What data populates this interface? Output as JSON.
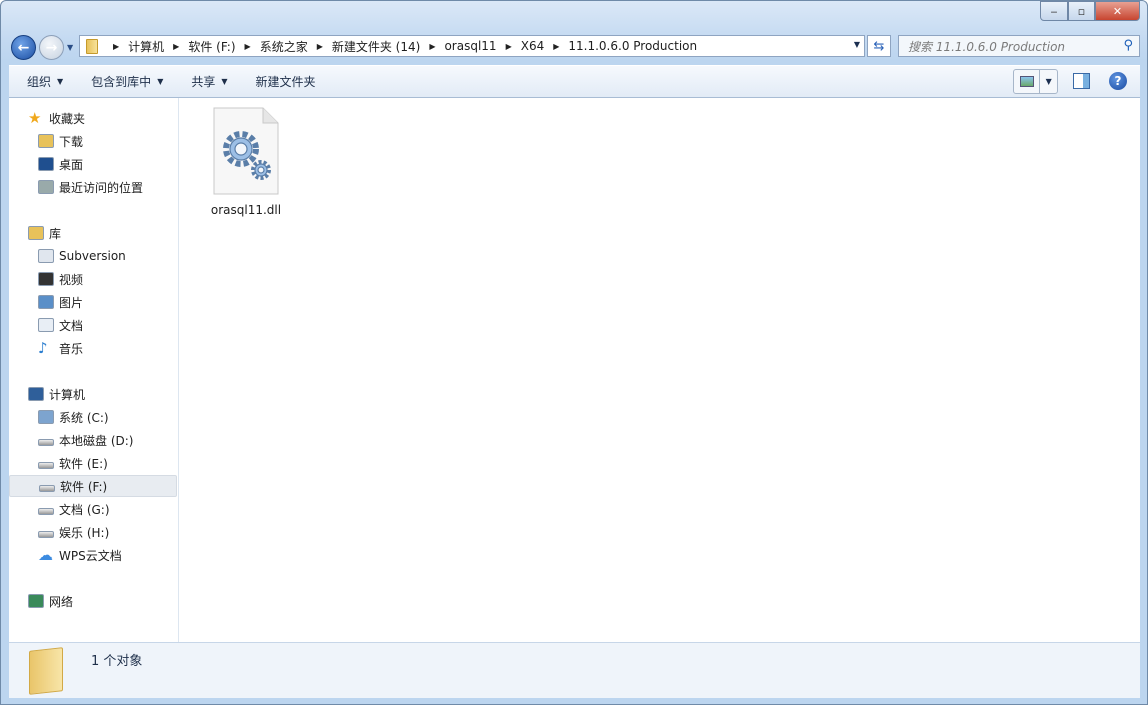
{
  "window": {
    "minimize": "‒",
    "maximize": "▫",
    "close": "✕"
  },
  "address": {
    "crumbs": [
      "计算机",
      "软件 (F:)",
      "系统之家",
      "新建文件夹 (14)",
      "orasql11",
      "X64",
      "11.1.0.6.0 Production"
    ]
  },
  "search": {
    "placeholder": "搜索 11.1.0.6.0 Production"
  },
  "toolbar": {
    "organize": "组织",
    "include_library": "包含到库中",
    "share": "共享",
    "new_folder": "新建文件夹"
  },
  "sidebar": {
    "favorites": {
      "label": "收藏夹",
      "items": [
        "下载",
        "桌面",
        "最近访问的位置"
      ]
    },
    "libraries": {
      "label": "库",
      "items": [
        "Subversion",
        "视频",
        "图片",
        "文档",
        "音乐"
      ]
    },
    "computer": {
      "label": "计算机",
      "items": [
        "系统 (C:)",
        "本地磁盘 (D:)",
        "软件 (E:)",
        "软件 (F:)",
        "文档 (G:)",
        "娱乐 (H:)",
        "WPS云文档"
      ]
    },
    "network": {
      "label": "网络"
    },
    "selected": "软件 (F:)"
  },
  "files": [
    {
      "name": "orasql11.dll",
      "type": "dll-gear-icon"
    }
  ],
  "status": {
    "text": "1 个对象"
  }
}
